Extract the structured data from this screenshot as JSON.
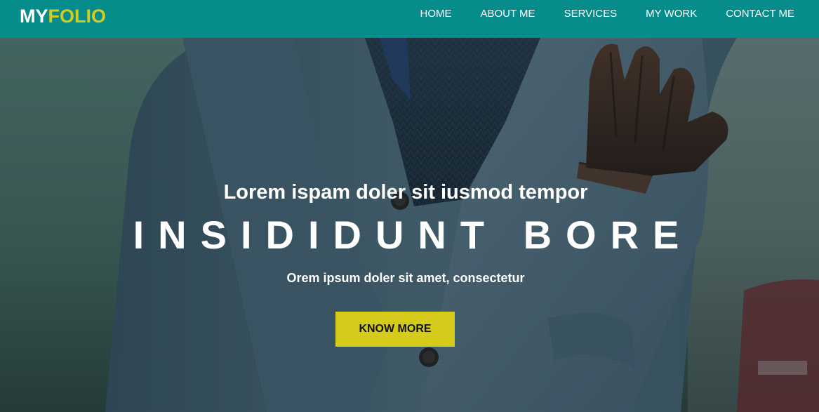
{
  "brand": {
    "logo_part1": "MY",
    "logo_part2": "FOLIO"
  },
  "nav": {
    "items": [
      {
        "label": "HOME"
      },
      {
        "label": "ABOUT ME"
      },
      {
        "label": "SERVICES"
      },
      {
        "label": "MY WORK"
      },
      {
        "label": "CONTACT ME"
      }
    ]
  },
  "hero": {
    "subtitle": "Lorem ispam doler sit iusmod tempor",
    "title": "INSIDIDUNT BORE",
    "text": "Orem ipsum doler sit amet, consectetur",
    "cta_label": "KNOW MORE"
  },
  "colors": {
    "navbar": "#078c8c",
    "accent": "#d4cc1c",
    "text": "#ffffff"
  }
}
